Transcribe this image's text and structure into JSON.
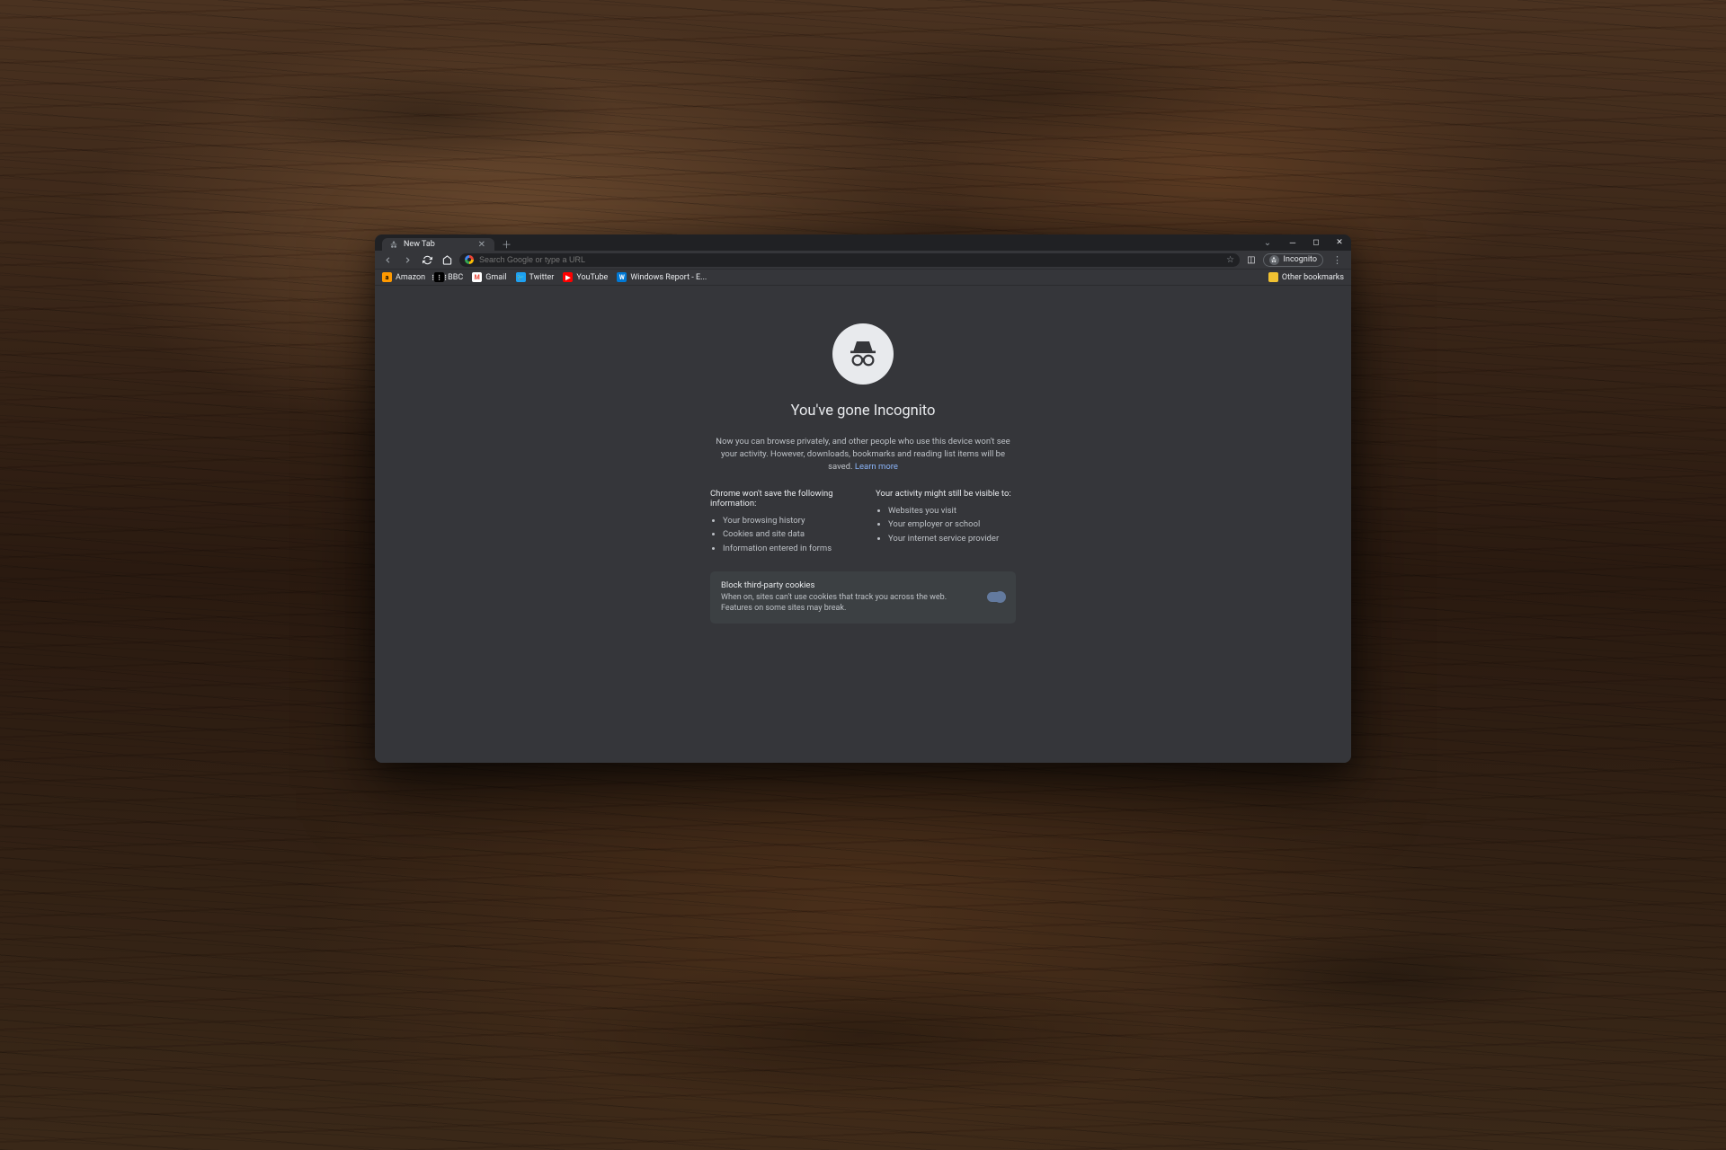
{
  "tab": {
    "title": "New Tab"
  },
  "omnibox": {
    "placeholder": "Search Google or type a URL"
  },
  "profile": {
    "label": "Incognito"
  },
  "bookmarks": {
    "items": [
      {
        "label": "Amazon",
        "bg": "#ff9900",
        "fg": "#000",
        "ico": "a"
      },
      {
        "label": "BBC",
        "bg": "#000",
        "fg": "#fff",
        "ico": "⋮⋮⋮"
      },
      {
        "label": "Gmail",
        "bg": "#fff",
        "fg": "#ea4335",
        "ico": "M"
      },
      {
        "label": "Twitter",
        "bg": "#1da1f2",
        "fg": "#fff",
        "ico": "🐦"
      },
      {
        "label": "YouTube",
        "bg": "#ff0000",
        "fg": "#fff",
        "ico": "▶"
      },
      {
        "label": "Windows Report - E...",
        "bg": "#0078d4",
        "fg": "#fff",
        "ico": "W"
      }
    ],
    "other": "Other bookmarks"
  },
  "incognito": {
    "headline": "You've gone Incognito",
    "desc": "Now you can browse privately, and other people who use this device won't see your activity. However, downloads, bookmarks and reading list items will be saved.",
    "learn_more": "Learn more",
    "col1_title": "Chrome won't save the following information:",
    "col1_items": [
      "Your browsing history",
      "Cookies and site data",
      "Information entered in forms"
    ],
    "col2_title": "Your activity might still be visible to:",
    "col2_items": [
      "Websites you visit",
      "Your employer or school",
      "Your internet service provider"
    ],
    "cookie_title": "Block third-party cookies",
    "cookie_desc": "When on, sites can't use cookies that track you across the web. Features on some sites may break."
  }
}
